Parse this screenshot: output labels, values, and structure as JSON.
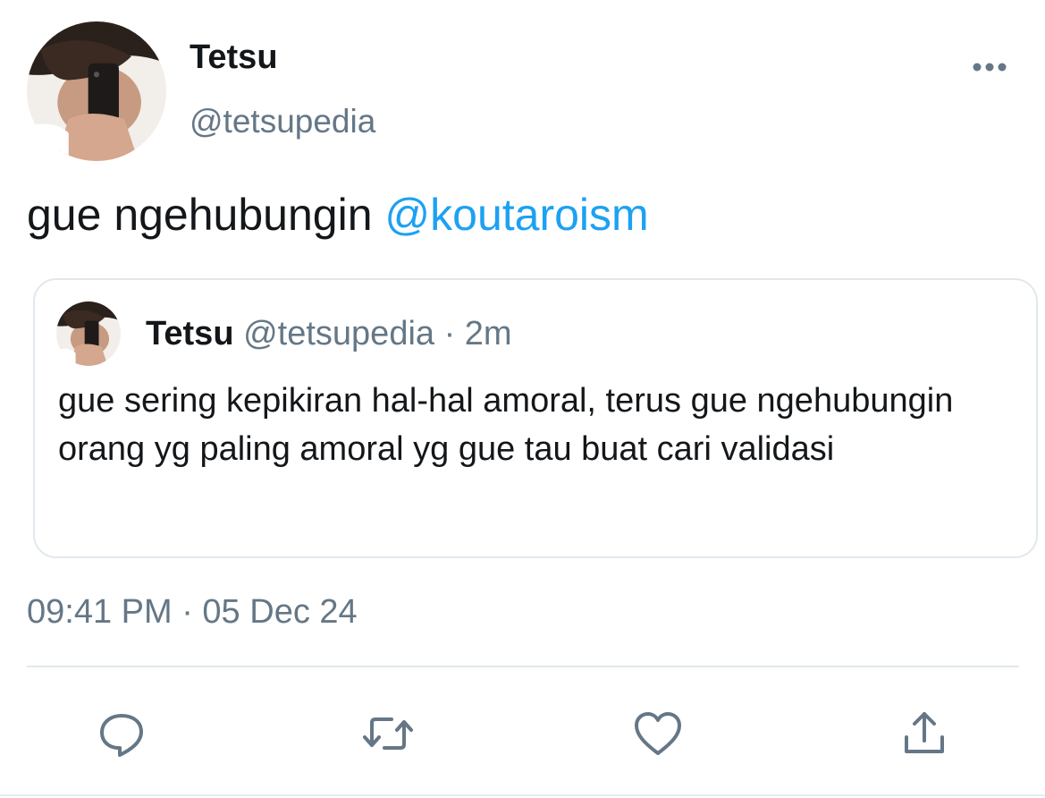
{
  "tweet": {
    "author": {
      "display_name": "Tetsu",
      "handle": "@tetsupedia",
      "avatar_icon": "profile-photo"
    },
    "text_plain": "gue ngehubungin ",
    "text_mention": "@koutaroism",
    "timestamp": "09:41 PM · 05 Dec 24",
    "more_icon": "more-horizontal-icon"
  },
  "quoted_tweet": {
    "display_name": "Tetsu",
    "handle_meta": "@tetsupedia · 2m",
    "text": "gue sering kepikiran hal-hal amoral, terus gue ngehubungin orang yg paling amoral yg gue tau buat cari validasi"
  },
  "actions": [
    {
      "name": "reply",
      "icon": "reply-icon"
    },
    {
      "name": "retweet",
      "icon": "retweet-icon"
    },
    {
      "name": "like",
      "icon": "heart-icon"
    },
    {
      "name": "share",
      "icon": "share-icon"
    }
  ],
  "colors": {
    "text": "#14171a",
    "secondary": "#657786",
    "accent": "#1da1f2",
    "border": "#e1e8ed"
  }
}
